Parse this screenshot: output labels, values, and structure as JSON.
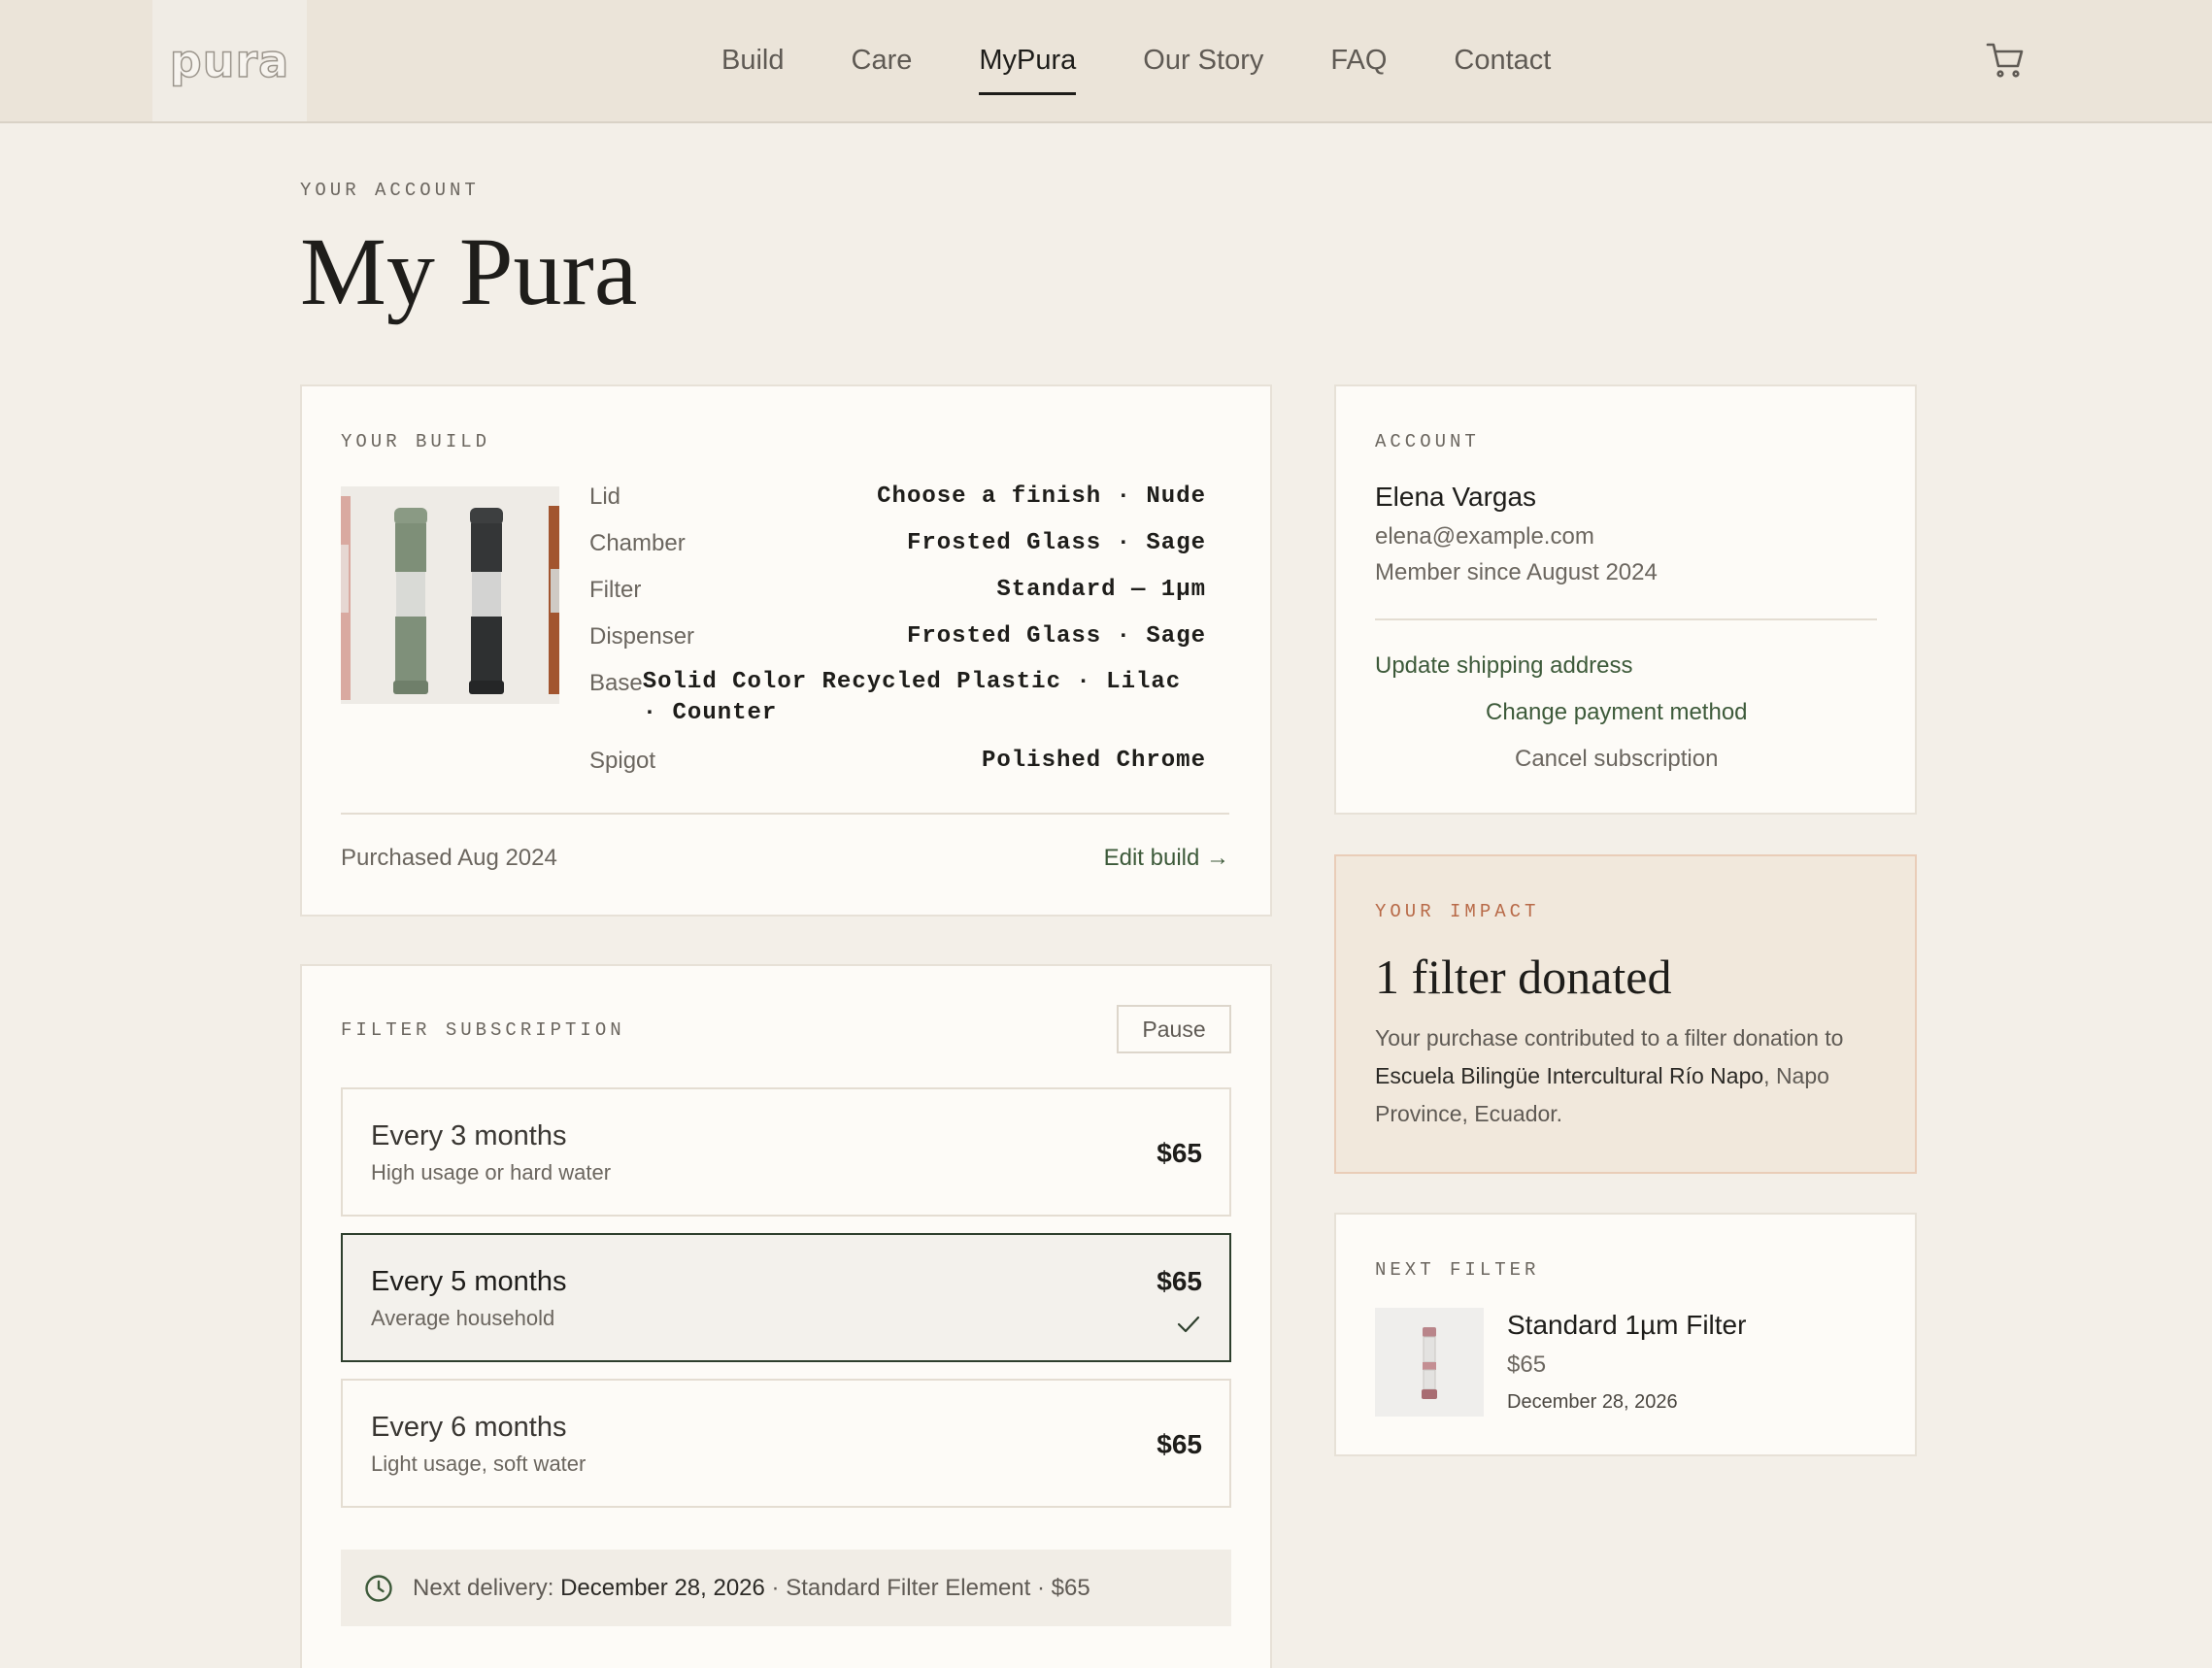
{
  "header": {
    "logo_text": "pura",
    "nav": [
      "Build",
      "Care",
      "MyPura",
      "Our Story",
      "FAQ",
      "Contact"
    ],
    "active_nav": "MyPura"
  },
  "page": {
    "eyebrow": "YOUR ACCOUNT",
    "title": "My Pura"
  },
  "build": {
    "eyebrow": "YOUR BUILD",
    "specs": [
      {
        "label": "Lid",
        "value": "Choose a finish · Nude"
      },
      {
        "label": "Chamber",
        "value": "Frosted Glass · Sage"
      },
      {
        "label": "Filter",
        "value": "Standard — 1µm"
      },
      {
        "label": "Dispenser",
        "value": "Frosted Glass · Sage"
      },
      {
        "label": "Base",
        "value": "Solid Color Recycled Plastic · Lilac · Counter"
      },
      {
        "label": "Spigot",
        "value": "Polished Chrome"
      }
    ],
    "purchased": "Purchased Aug 2024",
    "edit_label": "Edit build →"
  },
  "subscription": {
    "eyebrow": "FILTER SUBSCRIPTION",
    "pause_label": "Pause",
    "plans": [
      {
        "title": "Every 3 months",
        "desc": "High usage or hard water",
        "price": "$65"
      },
      {
        "title": "Every 5 months",
        "desc": "Average household",
        "price": "$65"
      },
      {
        "title": "Every 6 months",
        "desc": "Light usage, soft water",
        "price": "$65"
      }
    ],
    "next_delivery_prefix": "Next delivery: ",
    "next_delivery_date": "December 28, 2026",
    "next_delivery_suffix": " · Standard Filter Element · $65"
  },
  "account": {
    "eyebrow": "ACCOUNT",
    "name": "Elena Vargas",
    "email": "elena@example.com",
    "member_since": "Member since August 2024",
    "link_shipping": "Update shipping address",
    "link_payment": "Change payment method",
    "link_cancel": "Cancel subscription"
  },
  "impact": {
    "eyebrow": "YOUR IMPACT",
    "title": "1 filter donated",
    "body_prefix": "Your purchase contributed to a filter donation to ",
    "body_highlight": "Escuela Bilingüe Intercultural Río Napo",
    "body_suffix": ", Napo Province, Ecuador."
  },
  "next_filter": {
    "eyebrow": "NEXT FILTER",
    "name": "Standard 1µm Filter",
    "price": "$65",
    "date": "December 28, 2026"
  },
  "colors": {
    "accent_green": "#3d5a3a",
    "impact_accent": "#b86a48",
    "background": "#f3efe8"
  }
}
